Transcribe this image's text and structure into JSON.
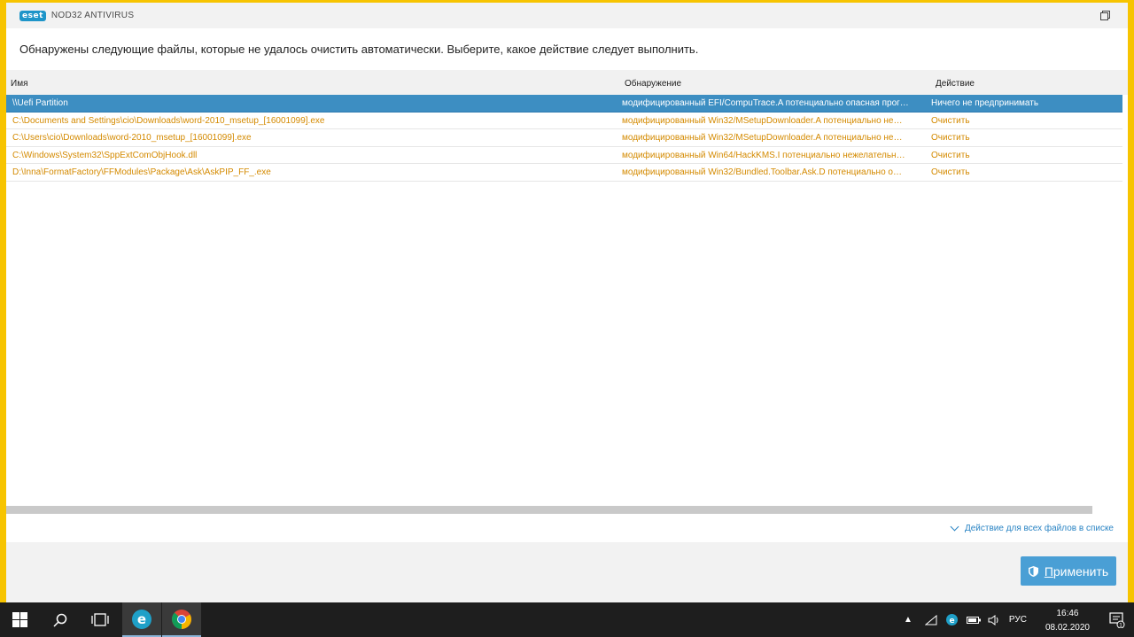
{
  "window": {
    "logo_text": "eset",
    "product_name": "NOD32 ANTIVIRUS"
  },
  "instruction": "Обнаружены следующие файлы, которые не удалось очистить автоматически. Выберите, какое действие следует выполнить.",
  "table": {
    "columns": {
      "name": "Имя",
      "detection": "Обнаружение",
      "action": "Действие"
    },
    "rows": [
      {
        "name": "\\\\Uefi Partition",
        "detection": "модифицированный EFI/CompuTrace.A потенциально опасная прог…",
        "action": "Ничего не предпринимать",
        "selected": true
      },
      {
        "name": "C:\\Documents and Settings\\cio\\Downloads\\word-2010_msetup_[16001099].exe",
        "detection": "модифицированный Win32/MSetupDownloader.A потенциально не…",
        "action": "Очистить",
        "selected": false
      },
      {
        "name": "C:\\Users\\cio\\Downloads\\word-2010_msetup_[16001099].exe",
        "detection": "модифицированный Win32/MSetupDownloader.A потенциально не…",
        "action": "Очистить",
        "selected": false
      },
      {
        "name": "C:\\Windows\\System32\\SppExtComObjHook.dll",
        "detection": "модифицированный Win64/HackKMS.I потенциально нежелательн…",
        "action": "Очистить",
        "selected": false
      },
      {
        "name": "D:\\Inna\\FormatFactory\\FFModules\\Package\\Ask\\AskPIP_FF_.exe",
        "detection": "модифицированный Win32/Bundled.Toolbar.Ask.D потенциально о…",
        "action": "Очистить",
        "selected": false
      }
    ]
  },
  "bulk_action_label": "Действие для всех файлов в списке",
  "apply_button": {
    "underlined_char": "П",
    "rest": "рименить"
  },
  "taskbar": {
    "language": "РУС",
    "time": "16:46",
    "date": "08.02.2020",
    "notification_count": "1"
  },
  "colors": {
    "accent": "#3d8ec2",
    "warning_text": "#d48a00",
    "border": "#f7c400"
  }
}
